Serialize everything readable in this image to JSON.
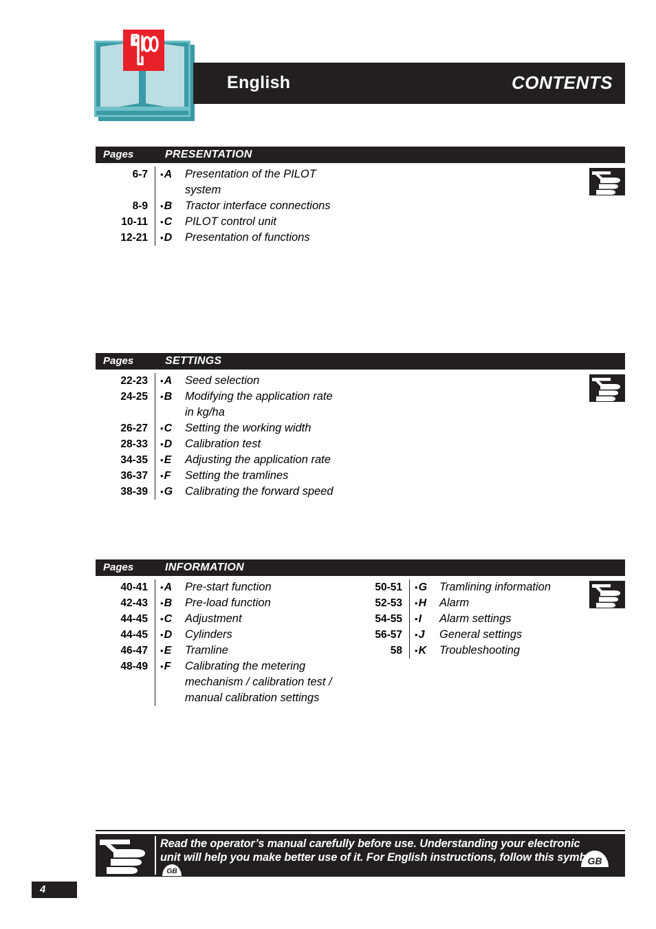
{
  "header": {
    "language": "English",
    "title": "CONTENTS",
    "book_icon": "open-book-icon",
    "logo": "sulky-logo"
  },
  "colors": {
    "bar_dark": "#231f20",
    "book_border_dark": "#3a9aa5",
    "book_border_light": "#6fc0c8",
    "book_page": "#bcdde2",
    "logo_red": "#e8202a",
    "white": "#ffffff"
  },
  "sections": [
    {
      "pages_label": "Pages",
      "title": "PRESENTATION",
      "symbol": "pointing-hand-icon",
      "columns": [
        {
          "rows": [
            {
              "pages": "6-7",
              "letter": "A",
              "text": "Presentation of the PILOT"
            },
            {
              "pages": "",
              "letter": "",
              "text": "system",
              "continuation": true
            },
            {
              "pages": "8-9",
              "letter": "B",
              "text": "Tractor interface connections"
            },
            {
              "pages": "10-11",
              "letter": "C",
              "text": "PILOT control unit"
            },
            {
              "pages": "12-21",
              "letter": "D",
              "text": "Presentation of functions"
            }
          ]
        }
      ]
    },
    {
      "pages_label": "Pages",
      "title": "SETTINGS",
      "symbol": "pointing-hand-icon",
      "columns": [
        {
          "rows": [
            {
              "pages": "22-23",
              "letter": "A",
              "text": "Seed selection"
            },
            {
              "pages": "24-25",
              "letter": "B",
              "text": "Modifying the application rate"
            },
            {
              "pages": "",
              "letter": "",
              "text": "in kg/ha",
              "continuation": true
            },
            {
              "pages": "26-27",
              "letter": "C",
              "text": "Setting the working width"
            },
            {
              "pages": "28-33",
              "letter": "D",
              "text": "Calibration test"
            },
            {
              "pages": "34-35",
              "letter": "E",
              "text": "Adjusting the application rate"
            },
            {
              "pages": "36-37",
              "letter": "F",
              "text": "Setting the tramlines"
            },
            {
              "pages": "38-39",
              "letter": "G",
              "text": "Calibrating the forward speed"
            }
          ]
        }
      ]
    },
    {
      "pages_label": "Pages",
      "title": "INFORMATION",
      "symbol": "pointing-hand-icon",
      "columns": [
        {
          "rows": [
            {
              "pages": "40-41",
              "letter": "A",
              "text": "Pre-start function"
            },
            {
              "pages": "42-43",
              "letter": "B",
              "text": "Pre-load function"
            },
            {
              "pages": "44-45",
              "letter": "C",
              "text": "Adjustment"
            },
            {
              "pages": "44-45",
              "letter": "D",
              "text": "Cylinders"
            },
            {
              "pages": "46-47",
              "letter": "E",
              "text": "Tramline"
            },
            {
              "pages": "48-49",
              "letter": "F",
              "text": "Calibrating the metering"
            },
            {
              "pages": "",
              "letter": "",
              "text": "mechanism / calibration test /",
              "continuation": true
            },
            {
              "pages": "",
              "letter": "",
              "text": "manual calibration settings",
              "continuation": true
            }
          ]
        },
        {
          "rows": [
            {
              "pages": "50-51",
              "letter": "G",
              "text": "Tramlining information"
            },
            {
              "pages": "52-53",
              "letter": "H",
              "text": "Alarm"
            },
            {
              "pages": "54-55",
              "letter": "I",
              "text": "Alarm settings"
            },
            {
              "pages": "56-57",
              "letter": "J",
              "text": "General settings"
            },
            {
              "pages": "58",
              "letter": "K",
              "text": "Troubleshooting"
            }
          ]
        }
      ]
    }
  ],
  "footer": {
    "symbol": "pointing-hand-icon",
    "text_part1": "Read the operator’s manual carefully before use. Understanding your electronic unit will help you make better use of it. For English instructions, follow this symbol:",
    "gb_badge": "GB",
    "gb_badge_right": "GB"
  },
  "page_number": "4"
}
